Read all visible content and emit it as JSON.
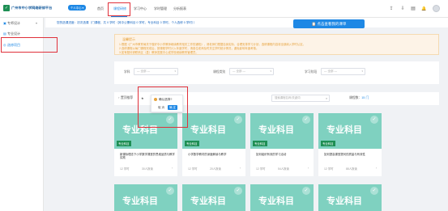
{
  "header": {
    "logo_glyph": "✓",
    "logo_text": "广州市中小学网络研修平台",
    "logo_badge": "个人中心 ▾",
    "nav": [
      "首页",
      "课程研修",
      "学习中心",
      "学时管理",
      "分析报表"
    ],
    "icons": [
      "upload-icon",
      "download-icon",
      "doc-icon",
      "bell-icon",
      "grid-icon"
    ],
    "icon_glyphs": [
      "⇪",
      "⇩",
      "▤",
      "🔔",
      "▦"
    ]
  },
  "sidebar": {
    "items": [
      {
        "label": "专师设计",
        "glyph": "▣",
        "arrow": "▾"
      },
      {
        "label": "专业设计",
        "glyph": "▤",
        "arrow": ""
      },
      {
        "label": "选修项目",
        "glyph": "◎",
        "arrow": ""
      }
    ]
  },
  "banner": {
    "text": "您的选课进度：初次选课（门课程，共 0 学时（其中公需科目 0 学时，专业科目 0 学时，个人选修 0 学时））",
    "button": "📋 点击查看我的课单"
  },
  "notice": {
    "title": "温馨提示",
    "lines": [
      "1.根据《广州市教育局关于做好中小学教师继续教育相关工作的通知》，请老师们根据自身实际，合理安排学习计划，选修课程内容将全部纳入学时认定。",
      "2.选修课程以每门课程完成后，按课程学时计入年度学时，请各位老师及时关注学时统计情况，避免影响年度考核。",
      "3.如有疑问请联系区（县）教师发展中心或学校继续教育管理员。"
    ]
  },
  "filters": [
    {
      "label": "学科",
      "value": "— 全部 —"
    },
    {
      "label": "课程类别",
      "value": "— 全部 —"
    },
    {
      "label": "学习阶段",
      "value": "— 全部 —"
    }
  ],
  "toolbar": {
    "back": "↑ 置顶推荐",
    "sort": "★",
    "search_placeholder": "搜索课程名称/关键词",
    "count_label": "课程数：",
    "count_value": "15 门"
  },
  "popup": {
    "text": "确认选择?",
    "cancel": "取 消",
    "ok": "确 定"
  },
  "cards": [
    {
      "title": "专业科目",
      "tag": "专业科目",
      "name": "新课标理念下小学数学课堂的思维品质与教学实践",
      "hours": "12 学时",
      "people": "30人报读",
      "arrow": "›"
    },
    {
      "title": "专业科目",
      "tag": "专业科目",
      "name": "小学数学教材的深度解读与教学",
      "hours": "12 学时",
      "people": "20人报读",
      "arrow": "›"
    },
    {
      "title": "专业科目",
      "tag": "专业科目",
      "name": "如何组织有效的学习活动",
      "hours": "12 学时",
      "people": "54人报读",
      "arrow": "›"
    },
    {
      "title": "专业科目",
      "tag": "专业科目",
      "name": "如何提高课堂提问的质量与有效性",
      "hours": "12 学时",
      "people": "88人报读",
      "arrow": "›"
    },
    {
      "title": "专业科目",
      "tag": "",
      "name": "",
      "hours": "",
      "people": "",
      "arrow": ""
    },
    {
      "title": "专业科目",
      "tag": "",
      "name": "",
      "hours": "",
      "people": "",
      "arrow": ""
    },
    {
      "title": "专业科目",
      "tag": "",
      "name": "",
      "hours": "",
      "people": "",
      "arrow": ""
    },
    {
      "title": "专业科目",
      "tag": "",
      "name": "",
      "hours": "",
      "people": "",
      "arrow": ""
    }
  ],
  "colors": {
    "accent": "#1e88e5",
    "brand_green": "#1e8f54",
    "card_teal": "#7fd1c0",
    "highlight_red": "#e0313b",
    "warning": "#e6a23c"
  }
}
